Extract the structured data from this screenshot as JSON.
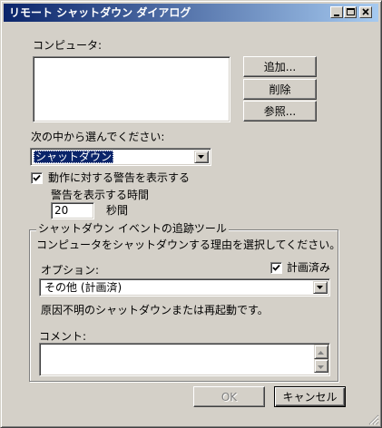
{
  "window": {
    "title": "リモート シャットダウン ダイアログ"
  },
  "computers": {
    "label": "コンピュータ:",
    "items": []
  },
  "buttons": {
    "add": "追加...",
    "remove": "削除",
    "browse": "参照...",
    "ok": "OK",
    "cancel": "キャンセル"
  },
  "action": {
    "label": "次の中から選んでください:",
    "selected": "シャットダウン"
  },
  "warning": {
    "checkbox_label": "動作に対する警告を表示する",
    "checked": true,
    "time_label": "警告を表示する時間",
    "seconds_value": "20",
    "seconds_unit": "秒間"
  },
  "tracker": {
    "group_label": "シャットダウン イベントの追跡ツール",
    "instruction": "コンピュータをシャットダウンする理由を選択してください。",
    "option_label": "オプション:",
    "planned_label": "計画済み",
    "planned_checked": true,
    "option_selected": "その他 (計画済)",
    "description": "原因不明のシャットダウンまたは再起動です。",
    "comment_label": "コメント:",
    "comment_value": ""
  },
  "colors": {
    "titlebar_start": "#0a246a",
    "titlebar_end": "#a6caf0",
    "face": "#d4d0c8",
    "highlight": "#0a246a"
  }
}
